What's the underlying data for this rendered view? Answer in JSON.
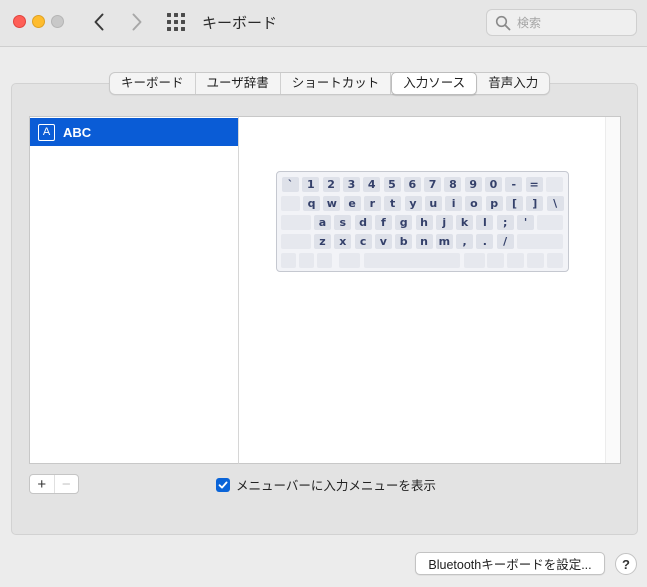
{
  "window": {
    "title": "キーボード",
    "search_placeholder": "検索"
  },
  "tabs": [
    {
      "label": "キーボード",
      "active": false
    },
    {
      "label": "ユーザ辞書",
      "active": false
    },
    {
      "label": "ショートカット",
      "active": false
    },
    {
      "label": "入力ソース",
      "active": true
    },
    {
      "label": "音声入力",
      "active": false
    }
  ],
  "input_sources": [
    {
      "badge": "A",
      "label": "ABC",
      "selected": true
    }
  ],
  "keyboard_preview": {
    "rows": [
      [
        "`",
        "1",
        "2",
        "3",
        "4",
        "5",
        "6",
        "7",
        "8",
        "9",
        "0",
        "-",
        "="
      ],
      [
        "q",
        "w",
        "e",
        "r",
        "t",
        "y",
        "u",
        "i",
        "o",
        "p",
        "[",
        "]",
        "\\"
      ],
      [
        "a",
        "s",
        "d",
        "f",
        "g",
        "h",
        "j",
        "k",
        "l",
        ";",
        "'"
      ],
      [
        "z",
        "x",
        "c",
        "v",
        "b",
        "n",
        "m",
        ",",
        ".",
        "/"
      ]
    ]
  },
  "buttons": {
    "add": "+",
    "remove": "−",
    "bluetooth": "Bluetoothキーボードを設定...",
    "help": "?"
  },
  "options": {
    "show_menu_label": "メニューバーに入力メニューを表示",
    "show_menu_checked": true
  },
  "colors": {
    "accent": "#0a5cd6",
    "key_text": "#34406a"
  }
}
